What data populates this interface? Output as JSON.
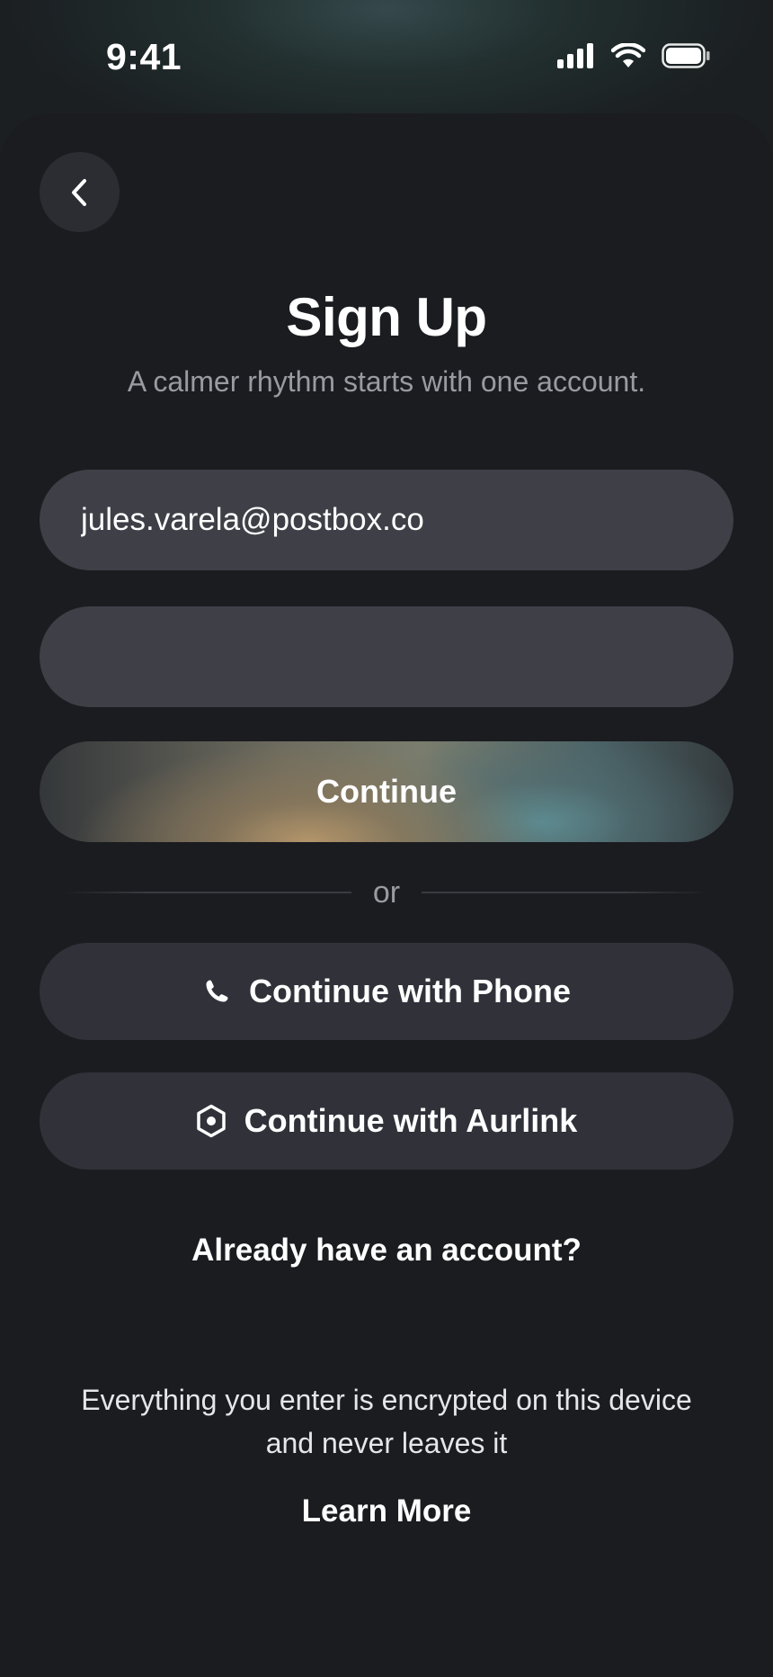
{
  "status_bar": {
    "time": "9:41",
    "icons": [
      "cellular-signal-icon",
      "wifi-icon",
      "battery-icon"
    ]
  },
  "navigation": {
    "back_icon": "chevron-left-icon"
  },
  "header": {
    "title": "Sign Up",
    "subtitle": "A calmer rhythm starts with one account."
  },
  "form": {
    "email_value": "jules.varela@postbox.co",
    "password_value": "",
    "continue_label": "Continue"
  },
  "divider": {
    "text": "or"
  },
  "alternatives": {
    "phone": {
      "label": "Continue with Phone",
      "icon": "phone-icon"
    },
    "aurlink": {
      "label": "Continue with Aurlink",
      "icon": "hexagon-icon"
    }
  },
  "signin": {
    "label": "Already have an account?"
  },
  "footer": {
    "privacy_line1": "Everything you enter is encrypted on this device",
    "privacy_line2": "and never leaves it",
    "learn_more": "Learn More"
  },
  "colors": {
    "background": "#1b1c20",
    "field": "#3e3f47",
    "button": "#303139",
    "muted_text": "#9a9ba0"
  }
}
